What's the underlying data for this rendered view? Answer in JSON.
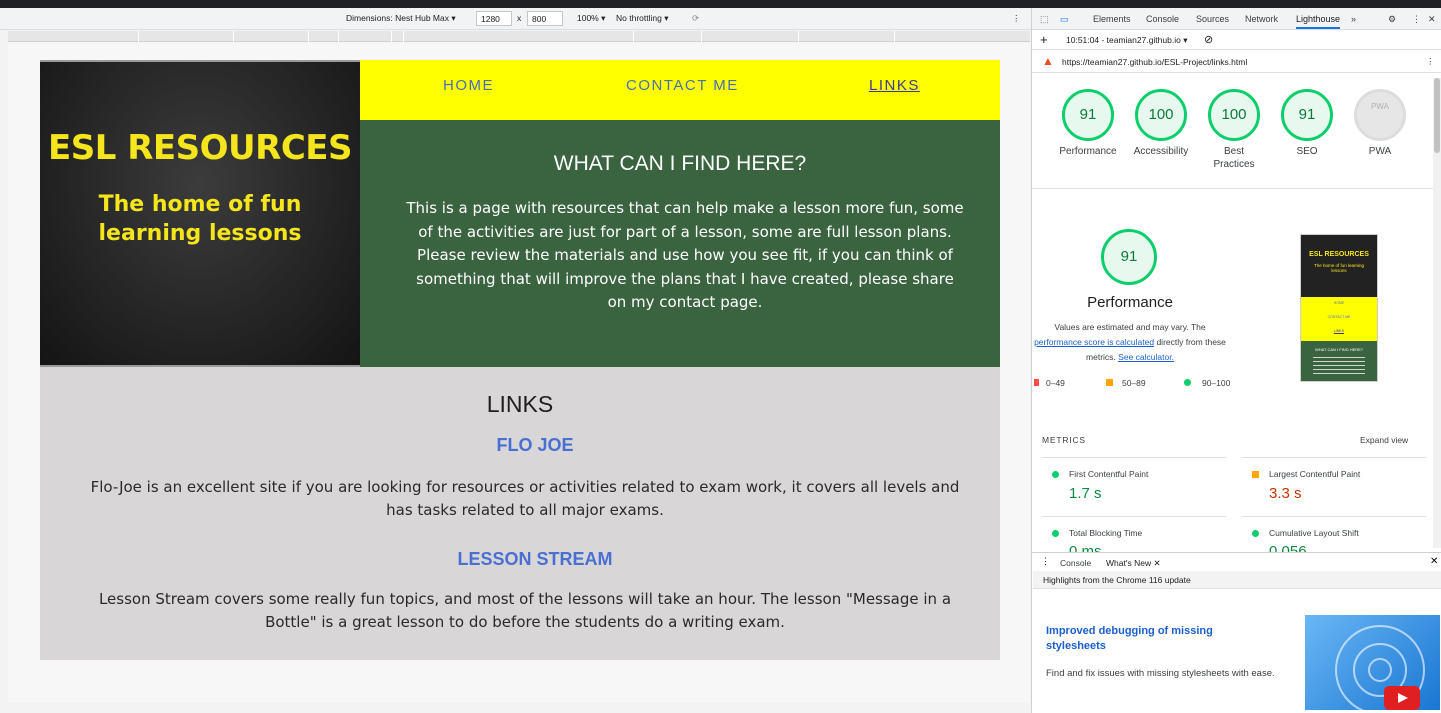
{
  "devbar": {
    "dimensions_label": "Dimensions: Nest Hub Max",
    "width_value": "1280",
    "times": "x",
    "height_value": "800",
    "zoom": "100%",
    "throttle": "No throttling"
  },
  "site": {
    "hero_title": "ESL RESOURCES",
    "hero_subtitle": "The home of fun learning lessons",
    "nav": [
      {
        "label": "HOME"
      },
      {
        "label": "CONTACT ME"
      },
      {
        "label": "LINKS"
      }
    ],
    "intro_heading": "WHAT CAN I FIND HERE?",
    "intro_text": "This is a page with resources that can help make a lesson more fun, some of the activities are just for part of a lesson, some are full lesson plans. Please review the materials and use how you see fit, if you can think of something that will improve the plans that I have created, please share on my contact page.",
    "links_heading": "LINKS",
    "link1_title": "FLO JOE",
    "link1_text": "Flo-Joe is an excellent site if you are looking for resources or activities related to exam work, it covers all levels and has tasks related to all major exams.",
    "link2_title": "LESSON STREAM",
    "link2_text": "Lesson Stream covers some really fun topics, and most of the lessons will take an hour. The lesson \"Message in a Bottle\" is a great lesson to do before the students do a writing exam."
  },
  "devtools": {
    "tabs": [
      "Elements",
      "Console",
      "Sources",
      "Network",
      "Lighthouse"
    ],
    "selected_tab": "Lighthouse",
    "report_time": "10:51:04 - teamian27.github.io",
    "url": "https://teamian27.github.io/ESL-Project/links.html",
    "scores": [
      {
        "value": "91",
        "label": "Performance"
      },
      {
        "value": "100",
        "label": "Accessibility"
      },
      {
        "value": "100",
        "label": "Best Practices"
      },
      {
        "value": "91",
        "label": "SEO"
      },
      {
        "value": "PWA",
        "label": "PWA"
      }
    ],
    "perf_score": "91",
    "perf_title": "Performance",
    "perf_note_1": "Values are estimated and may vary. The",
    "perf_note_link": "performance score is calculated",
    "perf_note_2": " directly from these",
    "perf_note_3": "metrics. ",
    "perf_note_link2": "See calculator.",
    "legend": [
      "0–49",
      "50–89",
      "90–100"
    ],
    "thumb_title": "ESL RESOURCES",
    "thumb_sub": "The home of fun learning lessons",
    "thumb_nav": [
      "HOME",
      "CONTACT ME",
      "LINKS"
    ],
    "thumb_heading": "WHAT CAN I FIND HERE?",
    "metrics_label": "METRICS",
    "expand_view": "Expand view",
    "metrics": [
      {
        "name": "First Contentful Paint",
        "value": "1.7 s",
        "color": "#0cce6b"
      },
      {
        "name": "Largest Contentful Paint",
        "value": "3.3 s",
        "color": "#ffa400"
      },
      {
        "name": "Total Blocking Time",
        "value": "0 ms",
        "color": "#0cce6b"
      },
      {
        "name": "Cumulative Layout Shift",
        "value": "0.056",
        "color": "#0cce6b"
      }
    ],
    "drawer_tabs": [
      "Console",
      "What's New"
    ],
    "highlights": "Highlights from the Chrome 116 update",
    "news_title": "Improved debugging of missing stylesheets",
    "news_text": "Find and fix issues with missing stylesheets with ease."
  },
  "colors": {
    "yellow": "#ffff00",
    "green": "#3a6440",
    "link_blue": "#4a6fd3",
    "score_green": "#0cce6b"
  }
}
